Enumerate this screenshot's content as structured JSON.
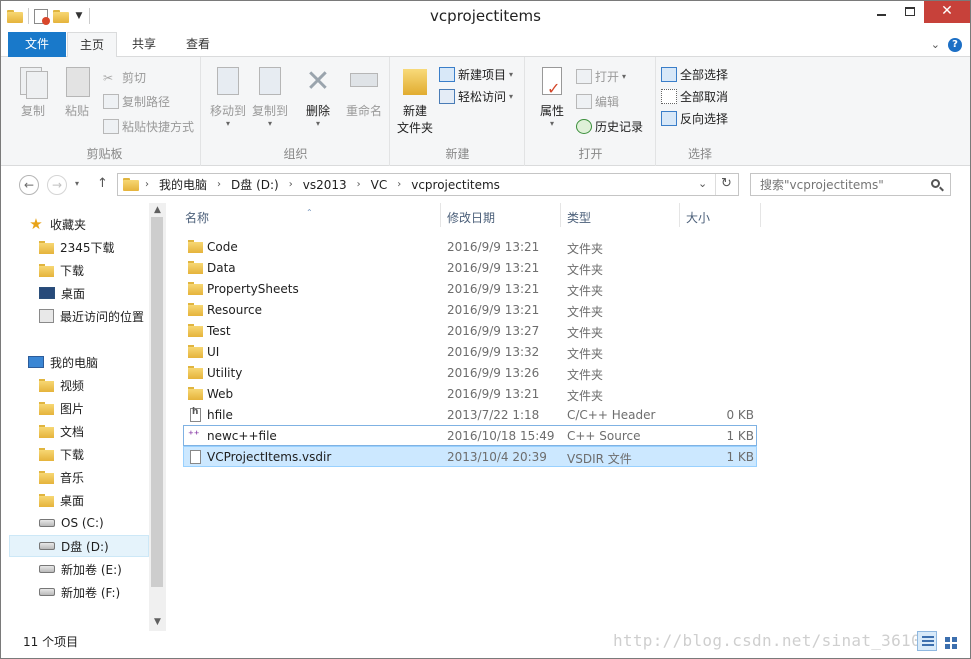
{
  "window": {
    "title": "vcprojectitems",
    "close_glyph": "✕"
  },
  "tabs": {
    "file": "文件",
    "home": "主页",
    "share": "共享",
    "view": "查看"
  },
  "ribbon": {
    "clipboard": {
      "label": "剪贴板",
      "copy": "复制",
      "paste": "粘贴",
      "cut": "剪切",
      "copy_path": "复制路径",
      "paste_shortcut": "粘贴快捷方式"
    },
    "organize": {
      "label": "组织",
      "move_to": "移动到",
      "copy_to": "复制到",
      "delete": "删除",
      "rename": "重命名"
    },
    "new": {
      "label": "新建",
      "new_folder_line1": "新建",
      "new_folder_line2": "文件夹",
      "new_item": "新建项目",
      "easy_access": "轻松访问"
    },
    "open": {
      "label": "打开",
      "properties": "属性",
      "open": "打开",
      "edit": "编辑",
      "history": "历史记录"
    },
    "select": {
      "label": "选择",
      "select_all": "全部选择",
      "select_none": "全部取消",
      "invert": "反向选择"
    }
  },
  "address": {
    "crumbs": [
      "我的电脑",
      "D盘 (D:)",
      "vs2013",
      "VC",
      "vcprojectitems"
    ],
    "search_placeholder": "搜索\"vcprojectitems\""
  },
  "nav": {
    "favorites": "收藏夹",
    "fav_items": [
      "2345下载",
      "下载",
      "桌面",
      "最近访问的位置"
    ],
    "computer": "我的电脑",
    "pc_items": [
      "视频",
      "图片",
      "文档",
      "下载",
      "音乐",
      "桌面",
      "OS (C:)",
      "D盘 (D:)",
      "新加卷 (E:)",
      "新加卷 (F:)"
    ]
  },
  "columns": {
    "name": "名称",
    "date": "修改日期",
    "type": "类型",
    "size": "大小"
  },
  "files": [
    {
      "name": "Code",
      "date": "2016/9/9 13:21",
      "type": "文件夹",
      "size": "",
      "icon": "folder-icon"
    },
    {
      "name": "Data",
      "date": "2016/9/9 13:21",
      "type": "文件夹",
      "size": "",
      "icon": "folder-icon"
    },
    {
      "name": "PropertySheets",
      "date": "2016/9/9 13:21",
      "type": "文件夹",
      "size": "",
      "icon": "folder-icon"
    },
    {
      "name": "Resource",
      "date": "2016/9/9 13:21",
      "type": "文件夹",
      "size": "",
      "icon": "folder-icon"
    },
    {
      "name": "Test",
      "date": "2016/9/9 13:27",
      "type": "文件夹",
      "size": "",
      "icon": "folder-icon"
    },
    {
      "name": "UI",
      "date": "2016/9/9 13:32",
      "type": "文件夹",
      "size": "",
      "icon": "folder-icon"
    },
    {
      "name": "Utility",
      "date": "2016/9/9 13:26",
      "type": "文件夹",
      "size": "",
      "icon": "folder-icon"
    },
    {
      "name": "Web",
      "date": "2016/9/9 13:21",
      "type": "文件夹",
      "size": "",
      "icon": "folder-icon"
    },
    {
      "name": "hfile",
      "date": "2013/7/22 1:18",
      "type": "C/C++ Header",
      "size": "0 KB",
      "icon": "header-file-icon"
    },
    {
      "name": "newc++file",
      "date": "2016/10/18 15:49",
      "type": "C++ Source",
      "size": "1 KB",
      "icon": "cpp-file-icon"
    },
    {
      "name": "VCProjectItems.vsdir",
      "date": "2013/10/4 20:39",
      "type": "VSDIR 文件",
      "size": "1 KB",
      "icon": "document-icon"
    }
  ],
  "status": {
    "count": "11 个项目",
    "watermark": "http://blog.csdn.net/sinat_3610"
  },
  "colors": {
    "accent": "#1979ca",
    "selection": "#cce8ff",
    "close": "#c7413a"
  }
}
